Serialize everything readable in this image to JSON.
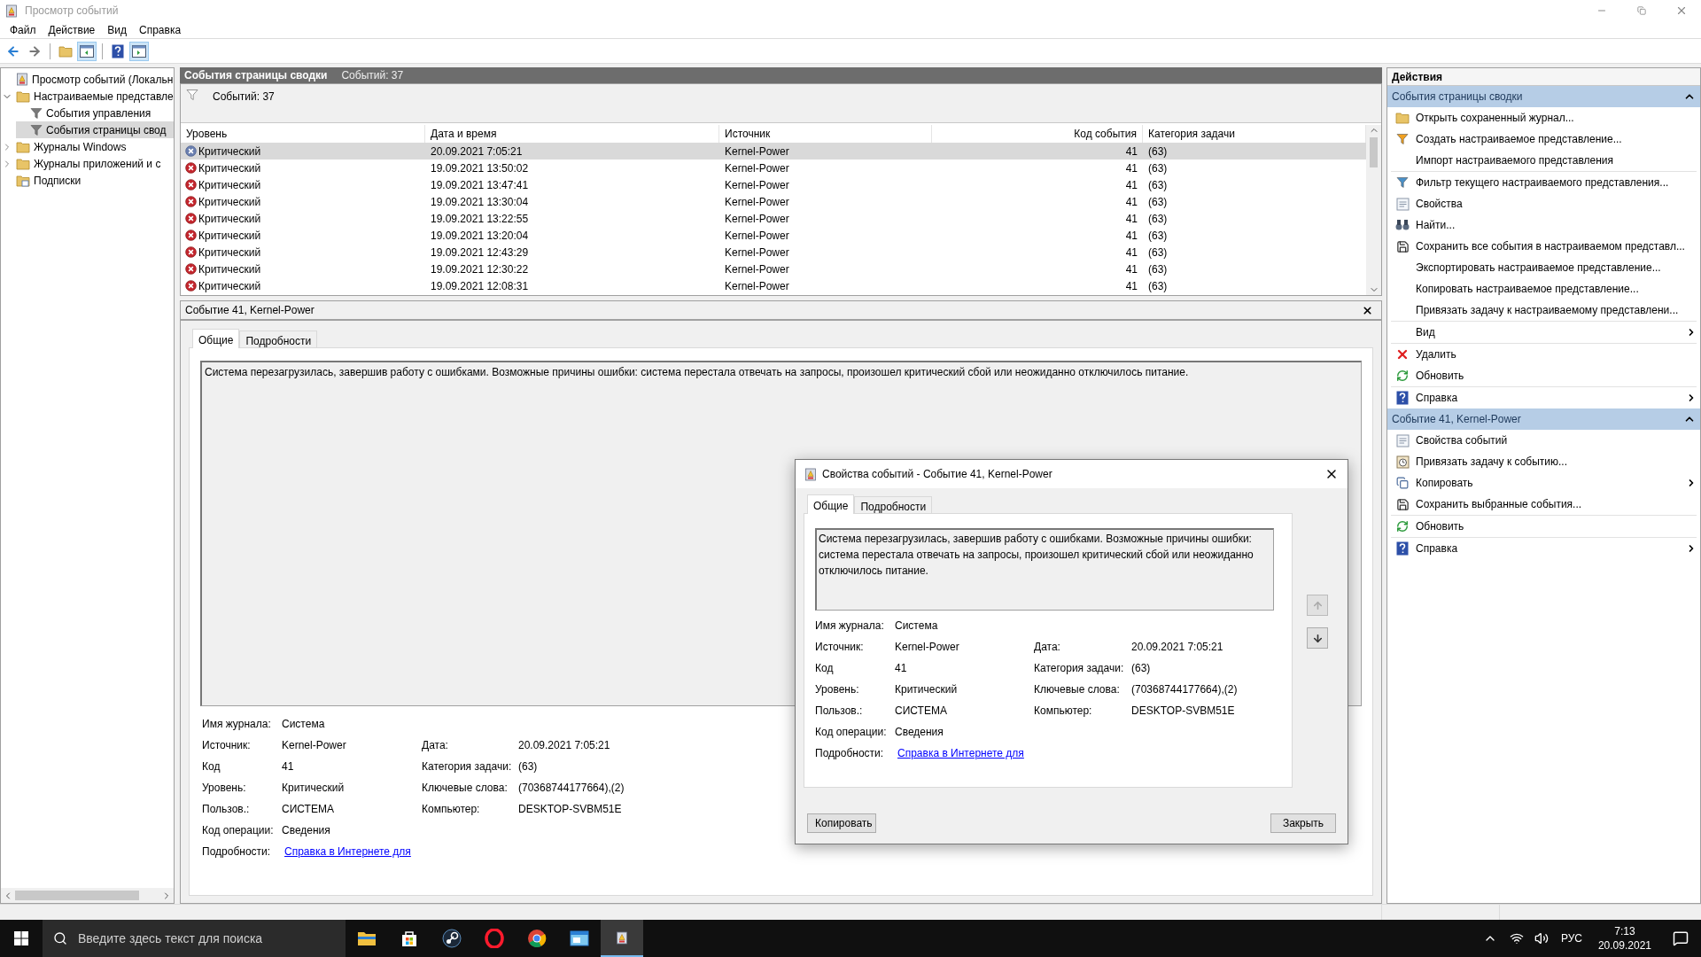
{
  "window": {
    "title": "Просмотр событий"
  },
  "menu": [
    "Файл",
    "Действие",
    "Вид",
    "Справка"
  ],
  "toolbar": [
    {
      "kind": "back",
      "pressed": false
    },
    {
      "kind": "forward",
      "pressed": false
    },
    {
      "kind": "up",
      "pressed": false
    },
    {
      "kind": "tree-pane",
      "pressed": true
    },
    {
      "kind": "help",
      "pressed": false
    },
    {
      "kind": "action-pane",
      "pressed": true
    }
  ],
  "tree": [
    {
      "label": "Просмотр событий (Локальн",
      "kind": "root",
      "selected": false,
      "children": [
        {
          "label": "Настраиваемые представле",
          "kind": "folder",
          "expanded": true,
          "selected": false,
          "children": [
            {
              "label": "События управления",
              "kind": "filter",
              "selected": false
            },
            {
              "label": "События страницы свод",
              "kind": "filter",
              "selected": true
            }
          ]
        },
        {
          "label": "Журналы Windows",
          "kind": "folder",
          "expanded": false,
          "selected": false
        },
        {
          "label": "Журналы приложений и с",
          "kind": "folder",
          "expanded": false,
          "selected": false
        },
        {
          "label": "Подписки",
          "kind": "subscription",
          "selected": false
        }
      ]
    }
  ],
  "view": {
    "title": "События страницы сводки",
    "count": "Событий: 37",
    "filter_count": "Событий: 37"
  },
  "table": {
    "columns": [
      "Уровень",
      "Дата и время",
      "Источник",
      "Код события",
      "Категория задачи"
    ],
    "rows": [
      {
        "level": "Критический",
        "datetime": "20.09.2021 7:05:21",
        "source": "Kernel-Power",
        "code": "41",
        "category": "(63)",
        "selected": true
      },
      {
        "level": "Критический",
        "datetime": "19.09.2021 13:50:02",
        "source": "Kernel-Power",
        "code": "41",
        "category": "(63)",
        "selected": false
      },
      {
        "level": "Критический",
        "datetime": "19.09.2021 13:47:41",
        "source": "Kernel-Power",
        "code": "41",
        "category": "(63)",
        "selected": false
      },
      {
        "level": "Критический",
        "datetime": "19.09.2021 13:30:04",
        "source": "Kernel-Power",
        "code": "41",
        "category": "(63)",
        "selected": false
      },
      {
        "level": "Критический",
        "datetime": "19.09.2021 13:22:55",
        "source": "Kernel-Power",
        "code": "41",
        "category": "(63)",
        "selected": false
      },
      {
        "level": "Критический",
        "datetime": "19.09.2021 13:20:04",
        "source": "Kernel-Power",
        "code": "41",
        "category": "(63)",
        "selected": false
      },
      {
        "level": "Критический",
        "datetime": "19.09.2021 12:43:29",
        "source": "Kernel-Power",
        "code": "41",
        "category": "(63)",
        "selected": false
      },
      {
        "level": "Критический",
        "datetime": "19.09.2021 12:30:22",
        "source": "Kernel-Power",
        "code": "41",
        "category": "(63)",
        "selected": false
      },
      {
        "level": "Критический",
        "datetime": "19.09.2021 12:08:31",
        "source": "Kernel-Power",
        "code": "41",
        "category": "(63)",
        "selected": false
      }
    ]
  },
  "detail": {
    "title": "Событие 41, Kernel-Power",
    "tabs": [
      {
        "label": "Общие",
        "selected": true
      },
      {
        "label": "Подробности",
        "selected": false
      }
    ],
    "description": "Система перезагрузилась, завершив работу с ошибками. Возможные причины ошибки: система перестала отвечать на запросы, произошел критический сбой или неожиданно отключилось питание.",
    "fields_left": [
      {
        "label": "Имя журнала:",
        "value": "Система"
      },
      {
        "label": "Источник:",
        "value": "Kernel-Power"
      },
      {
        "label": "Код",
        "value": "41"
      },
      {
        "label": "Уровень:",
        "value": "Критический"
      },
      {
        "label": "Пользов.:",
        "value": "СИСТЕМА"
      },
      {
        "label": "Код операции:",
        "value": "Сведения"
      }
    ],
    "fields_right": [
      {
        "label": "Дата:",
        "value": "20.09.2021 7:05:21"
      },
      {
        "label": "Категория задачи:",
        "value": "(63)"
      },
      {
        "label": "Ключевые слова:",
        "value": "(70368744177664),(2)"
      },
      {
        "label": "Компьютер:",
        "value": "DESKTOP-SVBM51E"
      }
    ],
    "more": {
      "label": "Подробности:",
      "link": "Справка в Интернете для"
    }
  },
  "dialog": {
    "title": "Свойства событий - Событие 41, Kernel-Power",
    "tabs": [
      {
        "label": "Общие",
        "selected": true
      },
      {
        "label": "Подробности",
        "selected": false
      }
    ],
    "description": "Система перезагрузилась, завершив работу с ошибками. Возможные причины ошибки: система перестала отвечать на запросы, произошел критический сбой или неожиданно отключилось питание.",
    "fields_left": [
      {
        "label": "Имя журнала:",
        "value": "Система"
      },
      {
        "label": "Источник:",
        "value": "Kernel-Power"
      },
      {
        "label": "Код",
        "value": "41"
      },
      {
        "label": "Уровень:",
        "value": "Критический"
      },
      {
        "label": "Пользов.:",
        "value": "СИСТЕМА"
      },
      {
        "label": "Код операции:",
        "value": "Сведения"
      }
    ],
    "fields_right": [
      {
        "label": "Дата:",
        "value": "20.09.2021 7:05:21"
      },
      {
        "label": "Категория задачи:",
        "value": "(63)"
      },
      {
        "label": "Ключевые слова:",
        "value": "(70368744177664),(2)"
      },
      {
        "label": "Компьютер:",
        "value": "DESKTOP-SVBM51E"
      }
    ],
    "more": {
      "label": "Подробности:",
      "link": "Справка в Интернете для"
    },
    "buttons": [
      "Копировать",
      "Закрыть"
    ]
  },
  "actions": {
    "title": "Действия",
    "sections": [
      {
        "title": "События страницы сводки",
        "expanded": true,
        "groups": [
          [
            {
              "label": "Открыть сохраненный журнал...",
              "kind": "open"
            },
            {
              "label": "Создать настраиваемое представление...",
              "kind": "create-filter"
            },
            {
              "label": "Импорт настраиваемого представления"
            }
          ],
          [
            {
              "label": "Фильтр текущего настраиваемого представления...",
              "kind": "filter"
            },
            {
              "label": "Свойства",
              "kind": "properties"
            },
            {
              "label": "Найти...",
              "kind": "find"
            },
            {
              "label": "Сохранить все события в настраиваемом представл...",
              "kind": "save"
            },
            {
              "label": "Экспортировать настраиваемое представление..."
            },
            {
              "label": "Копировать настраиваемое представление..."
            },
            {
              "label": "Привязать задачу к настраиваемому представлени..."
            }
          ],
          [
            {
              "label": "Вид",
              "submenu": true
            }
          ],
          [
            {
              "label": "Удалить",
              "kind": "delete"
            },
            {
              "label": "Обновить",
              "kind": "refresh"
            }
          ],
          [
            {
              "label": "Справка",
              "kind": "help",
              "submenu": true
            }
          ]
        ]
      },
      {
        "title": "Событие 41, Kernel-Power",
        "expanded": true,
        "groups": [
          [
            {
              "label": "Свойства событий",
              "kind": "properties"
            },
            {
              "label": "Привязать задачу к событию...",
              "kind": "task"
            },
            {
              "label": "Копировать",
              "kind": "copy",
              "submenu": true
            },
            {
              "label": "Сохранить выбранные события...",
              "kind": "save"
            }
          ],
          [
            {
              "label": "Обновить",
              "kind": "refresh"
            }
          ],
          [
            {
              "label": "Справка",
              "kind": "help",
              "submenu": true
            }
          ]
        ]
      }
    ]
  },
  "taskbar": {
    "search": {
      "placeholder": "Введите здесь текст для поиска"
    },
    "apps": [
      {
        "kind": "explorer",
        "active": false
      },
      {
        "kind": "store",
        "active": false
      },
      {
        "kind": "steam",
        "active": false
      },
      {
        "kind": "opera",
        "active": false
      },
      {
        "kind": "chrome",
        "active": false
      },
      {
        "kind": "window",
        "active": false
      },
      {
        "kind": "viewer",
        "active": true
      }
    ],
    "language": "РУС",
    "time": "7:13",
    "date": "20.09.2021"
  }
}
